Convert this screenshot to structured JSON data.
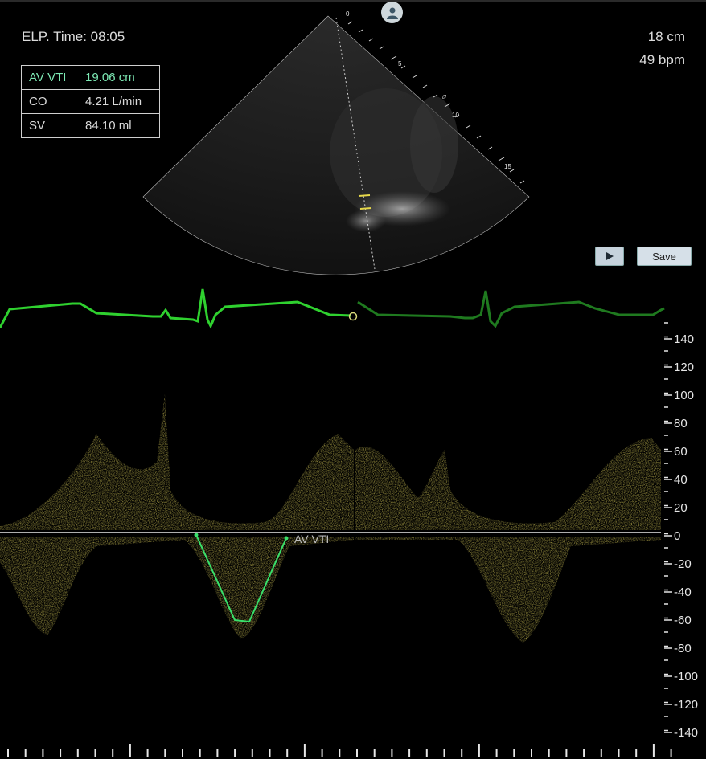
{
  "header": {
    "elapsed_time": "ELP. Time: 08:05",
    "depth": "18 cm",
    "heart_rate": "49 bpm"
  },
  "measurements": [
    {
      "label": "AV VTI",
      "value": "19.06 cm",
      "highlight": true
    },
    {
      "label": "CO",
      "value": "4.21 L/min",
      "highlight": false
    },
    {
      "label": "SV",
      "value": "84.10 ml",
      "highlight": false
    }
  ],
  "sector": {
    "depth_ticks": [
      "0",
      "5",
      "10",
      "15"
    ]
  },
  "controls": {
    "play_icon": "play-icon",
    "save_label": "Save",
    "patient_icon": "patient-icon"
  },
  "doppler": {
    "annotation": "AV VTI",
    "velocity_ticks": [
      "140",
      "120",
      "100",
      "80",
      "60",
      "40",
      "20",
      "0",
      "-20",
      "-40",
      "-60",
      "-80",
      "-100",
      "-120",
      "-140"
    ],
    "colors": {
      "spectrum": "#c9b21e",
      "ecg": "#2fd12f",
      "trace": "#39e06a",
      "highlight_text": "#7de9b4"
    }
  }
}
